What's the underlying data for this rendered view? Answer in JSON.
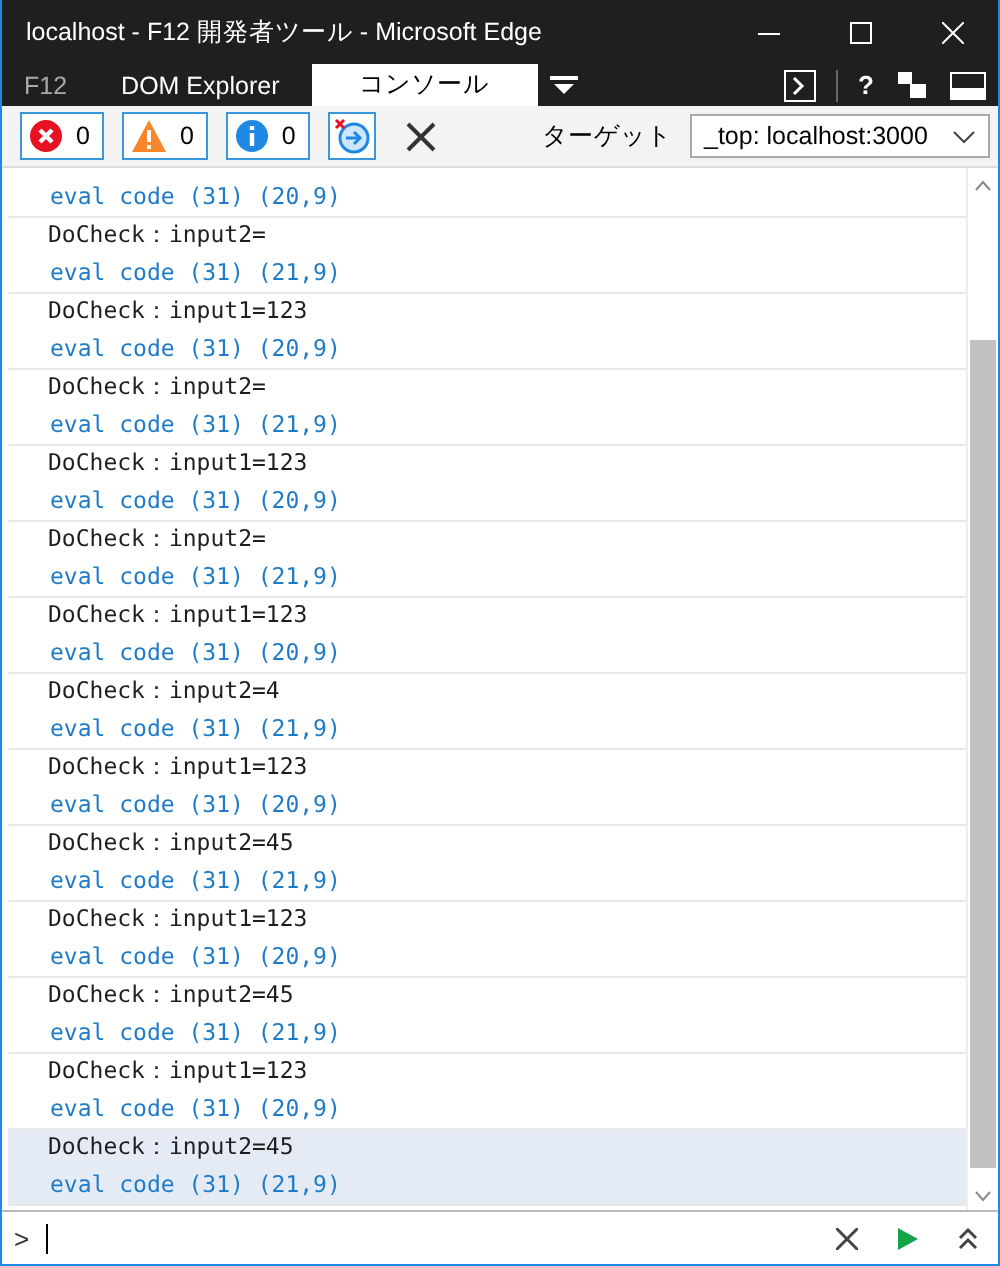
{
  "window": {
    "title": "localhost - F12 開発者ツール - Microsoft Edge"
  },
  "tabs": [
    {
      "label": "F12",
      "kind": "brand",
      "selected": false
    },
    {
      "label": "DOM Explorer",
      "kind": "tab",
      "selected": false
    },
    {
      "label": "コンソール",
      "kind": "tab",
      "selected": true
    }
  ],
  "tab_tools": {
    "help": "?"
  },
  "toolbar": {
    "filters": [
      {
        "kind": "error",
        "count": "0",
        "selected": true
      },
      {
        "kind": "warning",
        "count": "0",
        "selected": true
      },
      {
        "kind": "info",
        "count": "0",
        "selected": true
      }
    ],
    "clear_on_navigate": {
      "selected": true
    },
    "target_label": "ターゲット",
    "target_value": "_top: localhost:3000"
  },
  "console": {
    "entries": [
      {
        "source": "eval code (31) (20,9)",
        "highlighted": false
      },
      {
        "message": "DoCheck：input2=",
        "source": "eval code (31) (21,9)",
        "highlighted": false
      },
      {
        "message": "DoCheck：input1=123",
        "source": "eval code (31) (20,9)",
        "highlighted": false
      },
      {
        "message": "DoCheck：input2=",
        "source": "eval code (31) (21,9)",
        "highlighted": false
      },
      {
        "message": "DoCheck：input1=123",
        "source": "eval code (31) (20,9)",
        "highlighted": false
      },
      {
        "message": "DoCheck：input2=",
        "source": "eval code (31) (21,9)",
        "highlighted": false
      },
      {
        "message": "DoCheck：input1=123",
        "source": "eval code (31) (20,9)",
        "highlighted": false
      },
      {
        "message": "DoCheck：input2=4",
        "source": "eval code (31) (21,9)",
        "highlighted": false
      },
      {
        "message": "DoCheck：input1=123",
        "source": "eval code (31) (20,9)",
        "highlighted": false
      },
      {
        "message": "DoCheck：input2=45",
        "source": "eval code (31) (21,9)",
        "highlighted": false
      },
      {
        "message": "DoCheck：input1=123",
        "source": "eval code (31) (20,9)",
        "highlighted": false
      },
      {
        "message": "DoCheck：input2=45",
        "source": "eval code (31) (21,9)",
        "highlighted": false
      },
      {
        "message": "DoCheck：input1=123",
        "source": "eval code (31) (20,9)",
        "highlighted": false
      },
      {
        "message": "DoCheck：input2=45",
        "source": "eval code (31) (21,9)",
        "highlighted": true
      }
    ]
  },
  "input": {
    "prompt": ">"
  }
}
